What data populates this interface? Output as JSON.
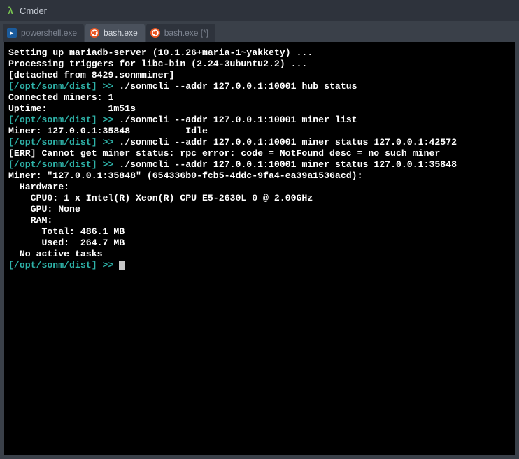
{
  "titlebar": {
    "app_name": "Cmder"
  },
  "tabs": [
    {
      "label": "powershell.exe",
      "icon": "ps",
      "active": false
    },
    {
      "label": "bash.exe",
      "icon": "ubuntu",
      "active": true
    },
    {
      "label": "bash.exe [*]",
      "icon": "ubuntu",
      "active": false
    }
  ],
  "terminal": {
    "lines": [
      {
        "segments": [
          {
            "cls": "white",
            "text": "Setting up mariadb-server (10.1.26+maria-1~yakkety) ..."
          }
        ]
      },
      {
        "segments": [
          {
            "cls": "white",
            "text": "Processing triggers for libc-bin (2.24-3ubuntu2.2) ..."
          }
        ]
      },
      {
        "segments": [
          {
            "cls": "white",
            "text": "[detached from 8429.sonmminer]"
          }
        ]
      },
      {
        "segments": [
          {
            "cls": "teal",
            "text": "[/opt/sonm/dist] >>"
          },
          {
            "cls": "white",
            "text": " ./sonmcli --addr 127.0.0.1:10001 hub status"
          }
        ]
      },
      {
        "segments": [
          {
            "cls": "white",
            "text": "Connected miners: 1"
          }
        ]
      },
      {
        "segments": [
          {
            "cls": "white",
            "text": "Uptime:           1m51s"
          }
        ]
      },
      {
        "segments": [
          {
            "cls": "teal",
            "text": "[/opt/sonm/dist] >>"
          },
          {
            "cls": "white",
            "text": " ./sonmcli --addr 127.0.0.1:10001 miner list"
          }
        ]
      },
      {
        "segments": [
          {
            "cls": "white",
            "text": "Miner: 127.0.0.1:35848          Idle"
          }
        ]
      },
      {
        "segments": [
          {
            "cls": "teal",
            "text": "[/opt/sonm/dist] >>"
          },
          {
            "cls": "white",
            "text": " ./sonmcli --addr 127.0.0.1:10001 miner status 127.0.0.1:42572"
          }
        ]
      },
      {
        "segments": [
          {
            "cls": "white",
            "text": "[ERR] Cannot get miner status: rpc error: code = NotFound desc = no such miner"
          }
        ]
      },
      {
        "segments": [
          {
            "cls": "teal",
            "text": "[/opt/sonm/dist] >>"
          },
          {
            "cls": "white",
            "text": " ./sonmcli --addr 127.0.0.1:10001 miner status 127.0.0.1:35848"
          }
        ]
      },
      {
        "segments": [
          {
            "cls": "white",
            "text": "Miner: \"127.0.0.1:35848\" (654336b0-fcb5-4ddc-9fa4-ea39a1536acd):"
          }
        ]
      },
      {
        "segments": [
          {
            "cls": "white",
            "text": "  Hardware:"
          }
        ]
      },
      {
        "segments": [
          {
            "cls": "white",
            "text": "    CPU0: 1 x Intel(R) Xeon(R) CPU E5-2630L 0 @ 2.00GHz"
          }
        ]
      },
      {
        "segments": [
          {
            "cls": "white",
            "text": "    GPU: None"
          }
        ]
      },
      {
        "segments": [
          {
            "cls": "white",
            "text": "    RAM:"
          }
        ]
      },
      {
        "segments": [
          {
            "cls": "white",
            "text": "      Total: 486.1 MB"
          }
        ]
      },
      {
        "segments": [
          {
            "cls": "white",
            "text": "      Used:  264.7 MB"
          }
        ]
      },
      {
        "segments": [
          {
            "cls": "white",
            "text": "  No active tasks"
          }
        ]
      },
      {
        "segments": [
          {
            "cls": "teal",
            "text": "[/opt/sonm/dist] >>"
          },
          {
            "cls": "white",
            "text": " "
          }
        ],
        "cursor": true
      }
    ]
  }
}
